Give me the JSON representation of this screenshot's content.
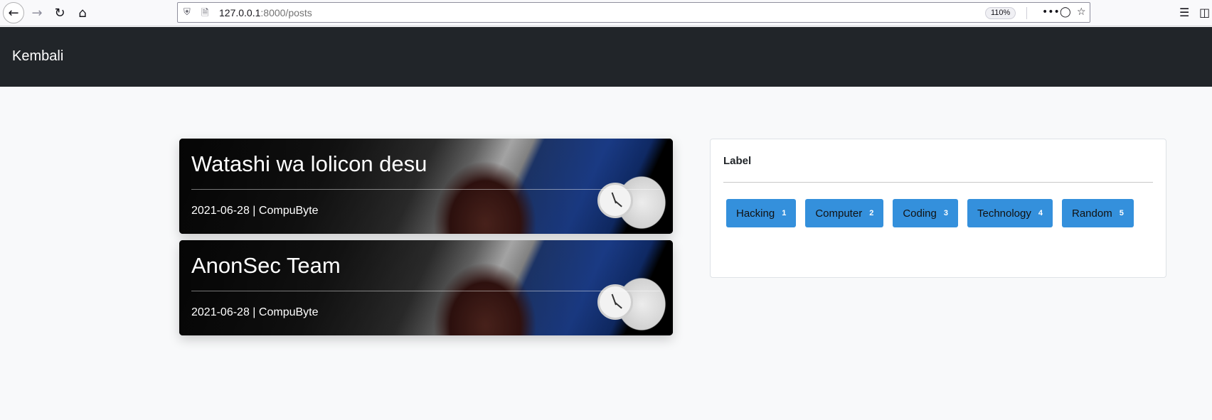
{
  "browser": {
    "url_host": "127.0.0.1",
    "url_rest": ":8000/posts",
    "zoom": "110%"
  },
  "navbar": {
    "brand": "Kembali"
  },
  "posts": [
    {
      "title": "Watashi wa lolicon desu",
      "date": "2021-06-28",
      "separator": "|",
      "author": "CompuByte"
    },
    {
      "title": "AnonSec Team",
      "date": "2021-06-28",
      "separator": "|",
      "author": "CompuByte"
    }
  ],
  "labels": {
    "heading": "Label",
    "items": [
      {
        "name": "Hacking",
        "count": "1"
      },
      {
        "name": "Computer",
        "count": "2"
      },
      {
        "name": "Coding",
        "count": "3"
      },
      {
        "name": "Technology",
        "count": "4"
      },
      {
        "name": "Random",
        "count": "5"
      }
    ]
  },
  "colors": {
    "navbar_bg": "#212529",
    "tag_bg": "#3490dc",
    "page_bg": "#f8f9fa"
  }
}
